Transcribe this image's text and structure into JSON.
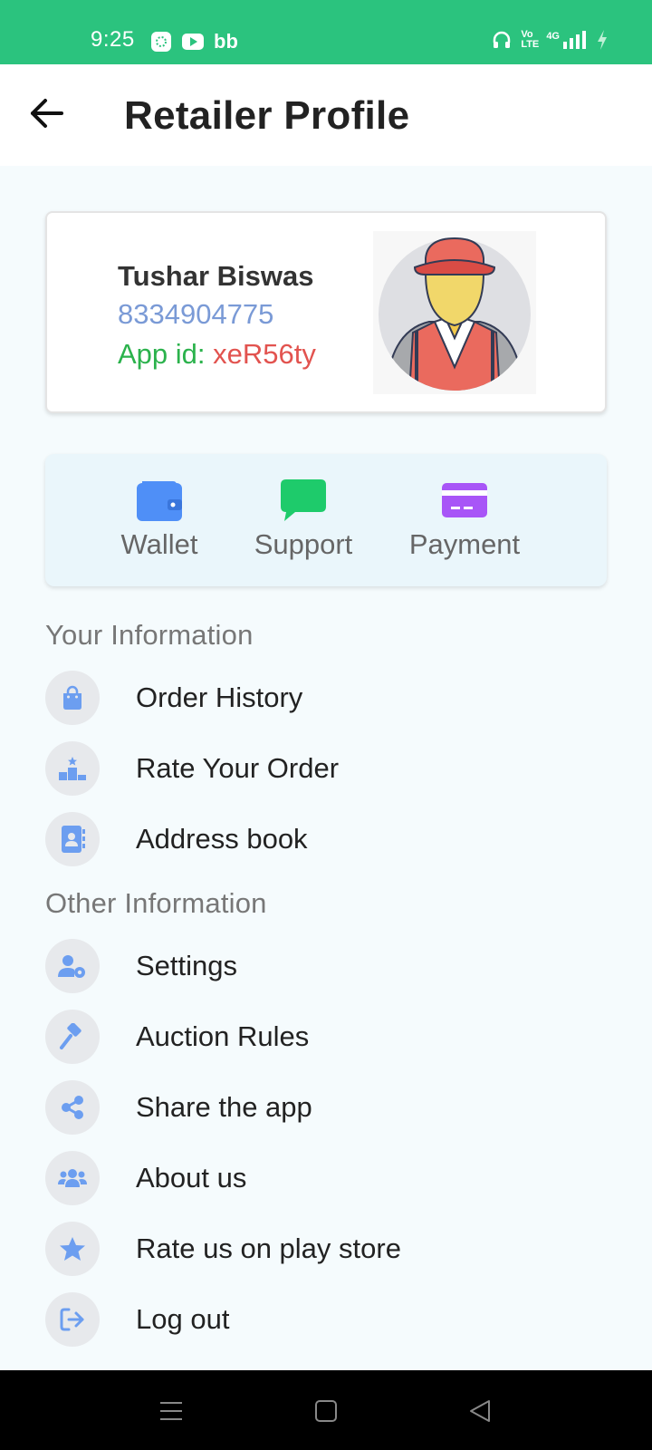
{
  "status_bar": {
    "time": "9:25",
    "left_icons": [
      "photo-icon",
      "youtube-icon",
      "bb-app-icon"
    ],
    "right_icons": [
      "headset-icon",
      "volte-icon",
      "4g-signal-icon",
      "battery-charging-icon"
    ],
    "bb_text": "bb",
    "volte_text": "Vo LTE",
    "net_text": "4G"
  },
  "app_bar": {
    "back_icon": "arrow-left-icon",
    "title": "Retailer Profile"
  },
  "profile": {
    "name": "Tushar Biswas",
    "phone": "8334904775",
    "app_id_label": "App id: ",
    "app_id_value": "xeR56ty",
    "avatar_icon": "retailer-avatar-icon"
  },
  "quick_actions": [
    {
      "label": "Wallet",
      "icon": "wallet-icon",
      "color": "#4f8ff7"
    },
    {
      "label": "Support",
      "icon": "chat-icon",
      "color": "#1ecb6b"
    },
    {
      "label": "Payment",
      "icon": "credit-card-icon",
      "color": "#a855f7"
    }
  ],
  "sections": {
    "your_information": "Your Information",
    "other_information": "Other Information"
  },
  "menu": {
    "order_history": "Order History",
    "rate_order": "Rate Your Order",
    "address_book": "Address book",
    "settings": "Settings",
    "auction_rules": "Auction Rules",
    "share_app": "Share the app",
    "about_us": "About us",
    "rate_play_store": "Rate us on play store",
    "log_out": "Log out"
  },
  "colors": {
    "status_bar": "#2bc37e",
    "menu_icon": "#6c9ef0",
    "background": "#f5fbfd"
  }
}
